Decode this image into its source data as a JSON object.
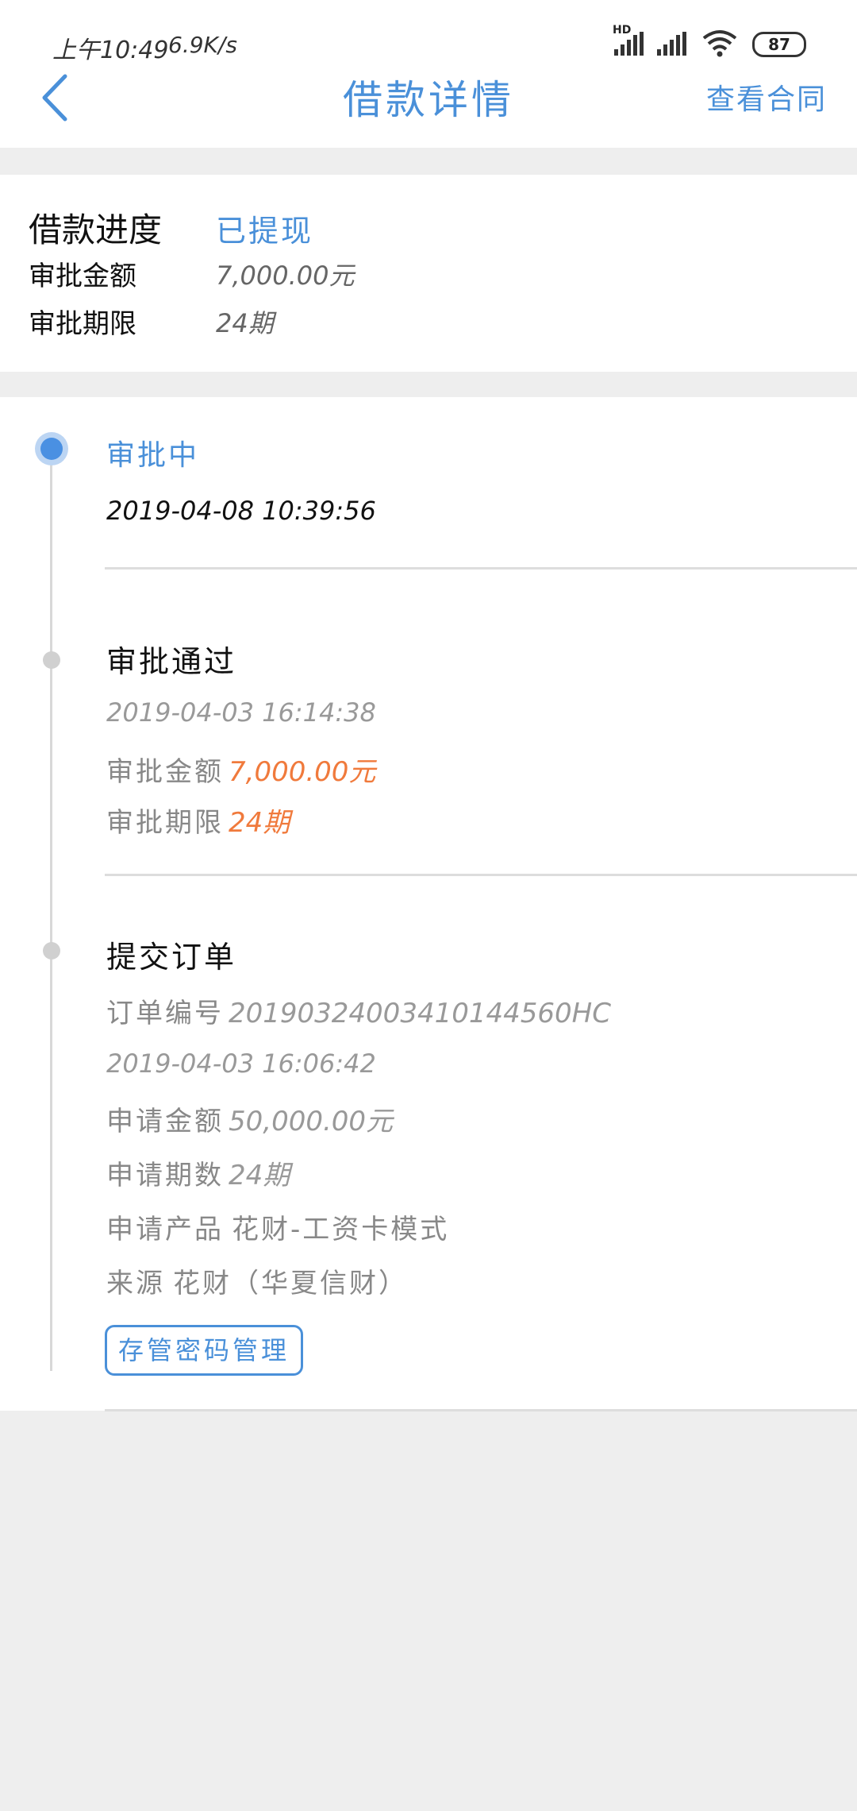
{
  "status_bar": {
    "time": "上午10:49",
    "speed": "6.9K/s",
    "battery": "87",
    "network_badge": "HD"
  },
  "header": {
    "title": "借款详情",
    "contract_link": "查看合同",
    "back_icon": "chevron-left-icon"
  },
  "summary": {
    "progress_label": "借款进度",
    "progress_value": "已提现",
    "amount_label": "审批金额",
    "amount_value": "7,000.00元",
    "term_label": "审批期限",
    "term_value": "24期"
  },
  "timeline": {
    "step1": {
      "title": "审批中",
      "datetime": "2019-04-08 10:39:56"
    },
    "step2": {
      "title": "审批通过",
      "datetime": "2019-04-03 16:14:38",
      "amount_label": "审批金额",
      "amount_value": "7,000.00元",
      "term_label": "审批期限",
      "term_value": "24期"
    },
    "step3": {
      "title": "提交订单",
      "order_label": "订单编号",
      "order_value": "20190324003410144560HC",
      "datetime": "2019-04-03 16:06:42",
      "apply_amount_label": "申请金额",
      "apply_amount_value": "50,000.00元",
      "apply_term_label": "申请期数",
      "apply_term_value": "24期",
      "product_label": "申请产品",
      "product_value": "花财-工资卡模式",
      "source_label": "来源",
      "source_value": "花财（华夏信财）",
      "password_button": "存管密码管理"
    }
  },
  "colors": {
    "accent": "#4a90d9",
    "orange": "#f07a3c",
    "background": "#eeeeee"
  }
}
